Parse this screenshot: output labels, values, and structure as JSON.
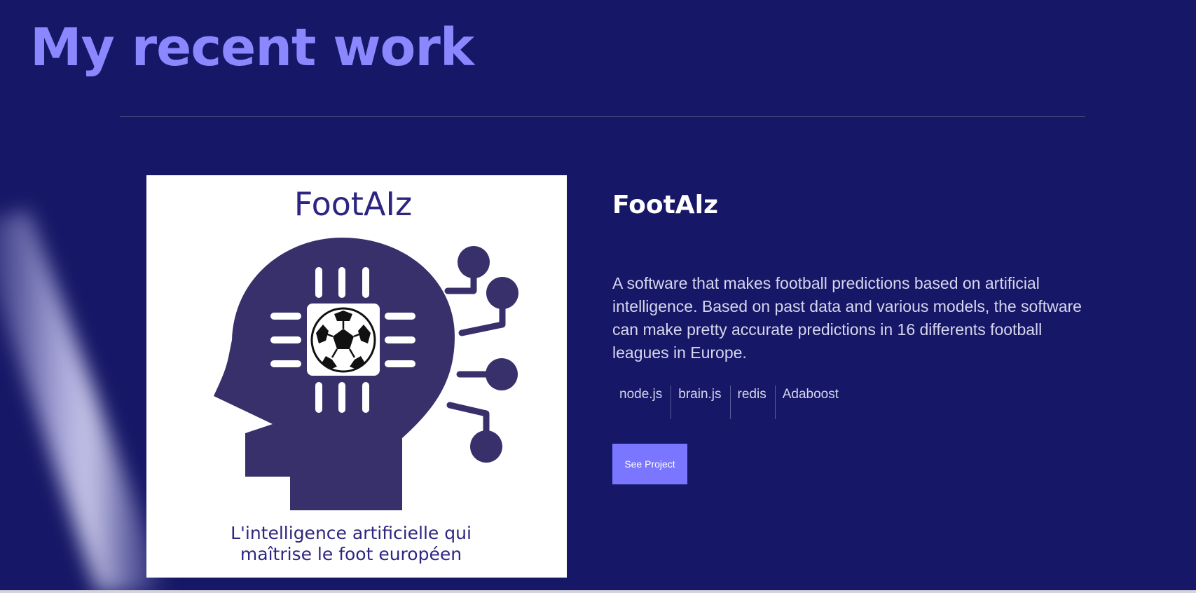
{
  "section": {
    "title": "My recent work"
  },
  "project": {
    "image": {
      "logo_title": "FootAIz",
      "caption_line1": "L'intelligence artificielle qui",
      "caption_line2": "maîtrise le foot européen"
    },
    "name": "FootAlz",
    "description": "A software that makes football predictions based on artificial intelligence. Based on past data and various models, the software can make pretty accurate predictions in 16 differents football leagues in Europe.",
    "tags": [
      "node.js",
      "brain.js",
      "redis",
      "Adaboost"
    ],
    "button_label": "See Project"
  },
  "colors": {
    "background": "#161766",
    "title": "#8a87ff",
    "accent_button": "#7b76ff",
    "logo_purple": "#38306b",
    "logo_text": "#2d2580"
  }
}
